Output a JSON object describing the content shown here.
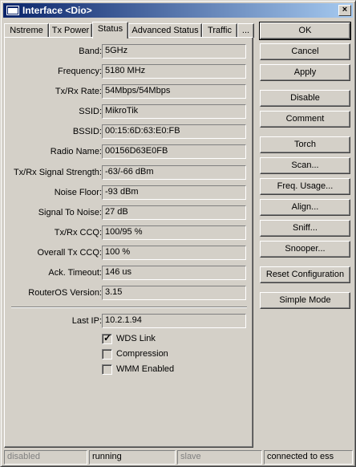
{
  "window": {
    "title": "Interface <Dio>",
    "close_label": "×"
  },
  "tabs": [
    {
      "label": "Nstreme"
    },
    {
      "label": "Tx Power"
    },
    {
      "label": "Status"
    },
    {
      "label": "Advanced Status"
    },
    {
      "label": "Traffic"
    },
    {
      "label": "..."
    }
  ],
  "fields": [
    {
      "label": "Band:",
      "value": "5GHz"
    },
    {
      "label": "Frequency:",
      "value": "5180 MHz"
    },
    {
      "label": "Tx/Rx Rate:",
      "value": "54Mbps/54Mbps"
    },
    {
      "label": "SSID:",
      "value": "MikroTik"
    },
    {
      "label": "BSSID:",
      "value": "00:15:6D:63:E0:FB"
    },
    {
      "label": "Radio Name:",
      "value": "00156D63E0FB"
    },
    {
      "label": "Tx/Rx Signal Strength:",
      "value": "-63/-66 dBm"
    },
    {
      "label": "Noise Floor:",
      "value": "-93 dBm"
    },
    {
      "label": "Signal To Noise:",
      "value": "27 dB"
    },
    {
      "label": "Tx/Rx CCQ:",
      "value": "100/95 %"
    },
    {
      "label": "Overall Tx CCQ:",
      "value": "100 %"
    },
    {
      "label": "Ack. Timeout:",
      "value": "146 us"
    },
    {
      "label": "RouterOS Version:",
      "value": "3.15"
    }
  ],
  "last_ip": {
    "label": "Last IP:",
    "value": "10.2.1.94"
  },
  "checkboxes": [
    {
      "label": "WDS Link",
      "checked": true
    },
    {
      "label": "Compression",
      "checked": false
    },
    {
      "label": "WMM Enabled",
      "checked": false
    }
  ],
  "buttons": {
    "ok": "OK",
    "cancel": "Cancel",
    "apply": "Apply",
    "disable": "Disable",
    "comment": "Comment",
    "torch": "Torch",
    "scan": "Scan...",
    "freq_usage": "Freq. Usage...",
    "align": "Align...",
    "sniff": "Sniff...",
    "snooper": "Snooper...",
    "reset_configuration": "Reset Configuration",
    "simple_mode": "Simple Mode"
  },
  "status_bar": {
    "state": "disabled",
    "run": "running",
    "role": "slave",
    "connection": "connected to ess"
  }
}
